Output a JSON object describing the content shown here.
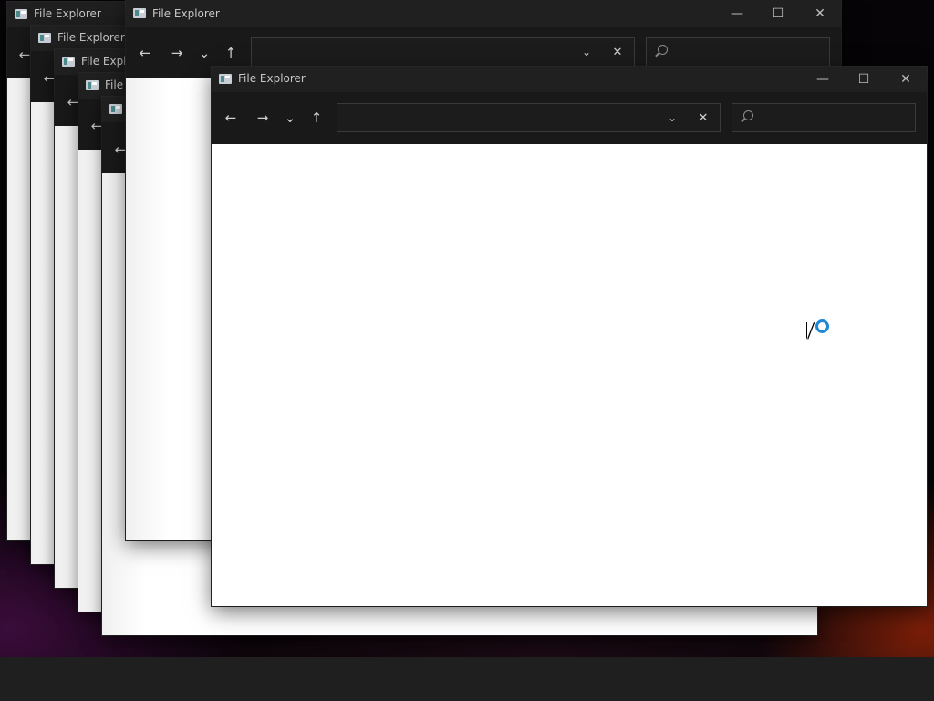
{
  "window": {
    "title": "File Explorer",
    "title_clipped_1": "File Expl",
    "title_clipped_2": "File"
  },
  "icons": {
    "back": "←",
    "forward": "→",
    "recent": "⌄",
    "up": "↑",
    "dropdown": "⌄",
    "clear": "✕",
    "minimize": "—",
    "maximize": "☐",
    "close": "✕"
  },
  "colors": {
    "accent": "#1e88d6",
    "titlebar": "#202020",
    "toolbar": "#191919",
    "taskbar": "#1f1f1f"
  },
  "address_bar": {
    "value": ""
  },
  "search": {
    "placeholder": ""
  }
}
